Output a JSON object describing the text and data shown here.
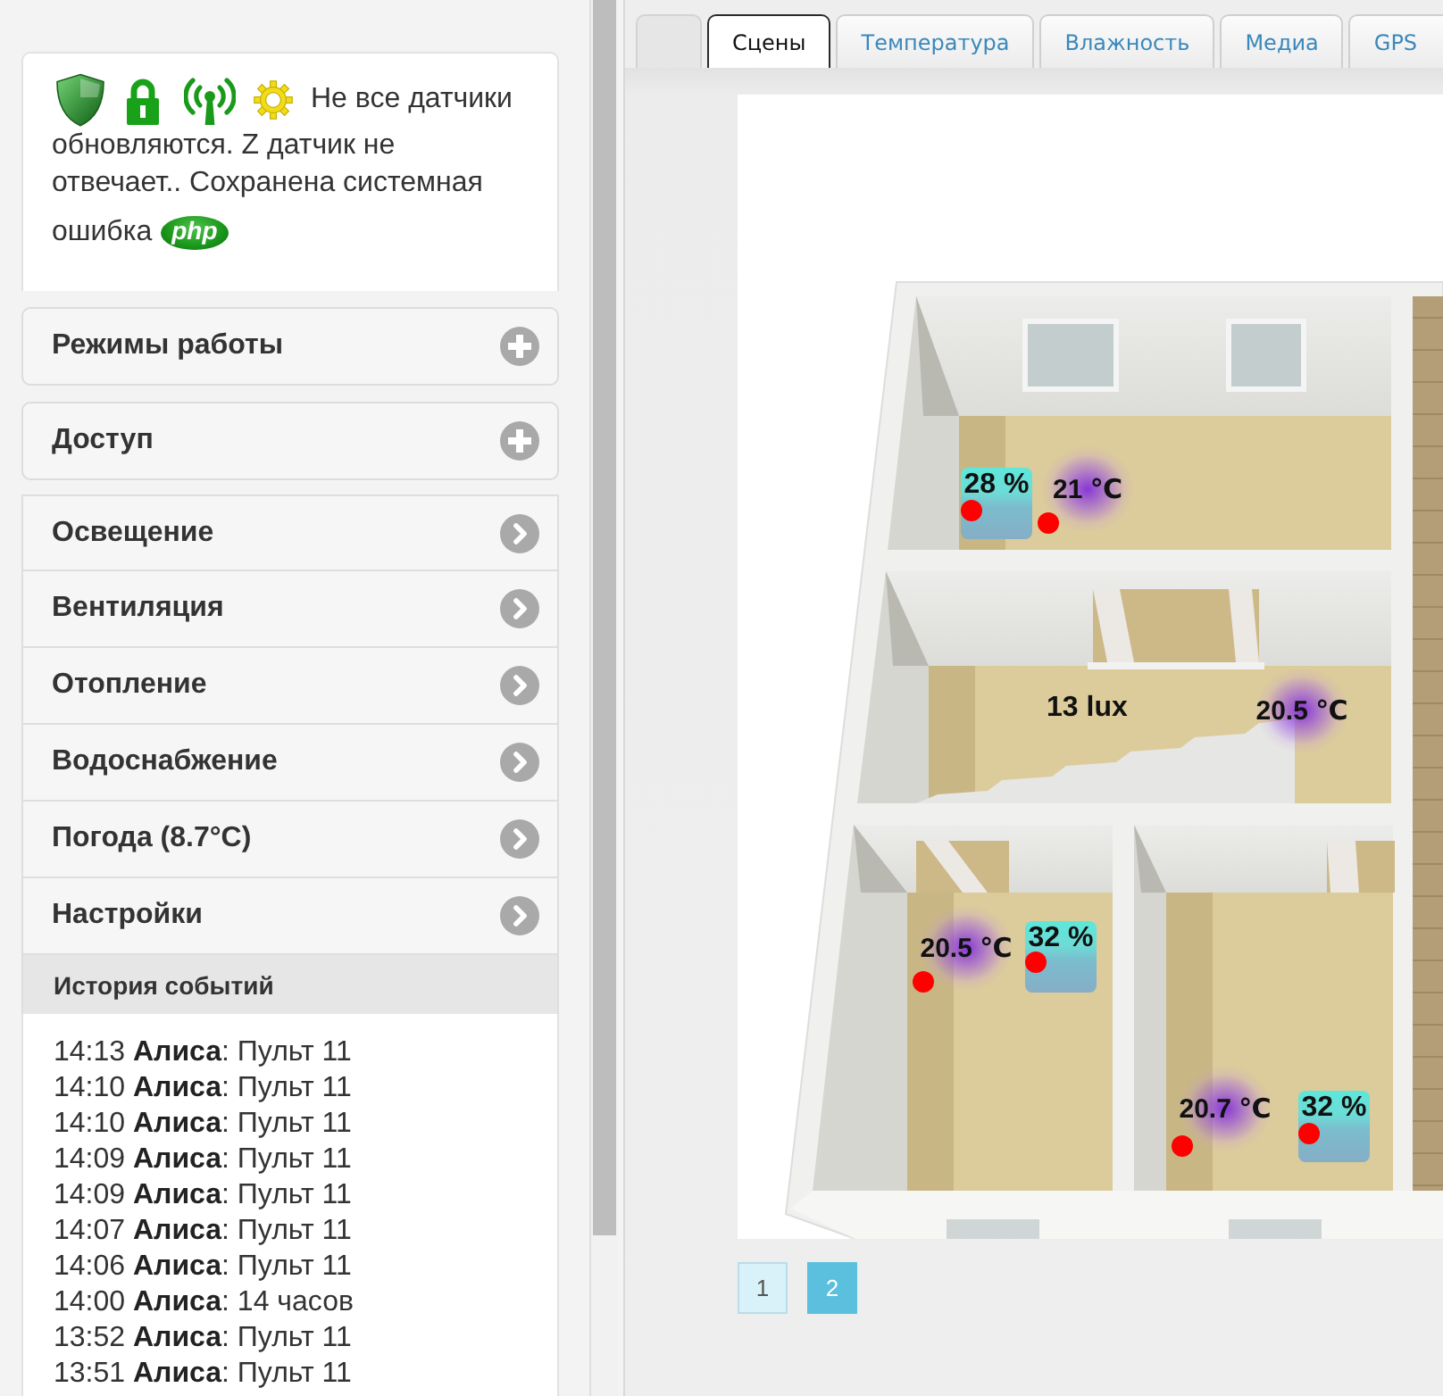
{
  "status": {
    "message": "Не все датчики обновляются. Z датчик не отвечает.. Сохранена системная ошибка",
    "badge": "php"
  },
  "sections": [
    {
      "label": "Режимы работы",
      "expanded": false
    },
    {
      "label": "Доступ",
      "expanded": false
    }
  ],
  "menu": [
    {
      "label": "Освещение"
    },
    {
      "label": "Вентиляция"
    },
    {
      "label": "Отопление"
    },
    {
      "label": "Водоснабжение"
    },
    {
      "label": "Погода (8.7°C)"
    },
    {
      "label": "Настройки"
    }
  ],
  "history": {
    "title": "История событий",
    "events": [
      "14:13 **Алиса**: Пульт 11",
      "14:10 **Алиса**: Пульт 11",
      "14:10 **Алиса**: Пульт 11",
      "14:09 **Алиса**: Пульт 11",
      "14:09 **Алиса**: Пульт 11",
      "14:07 **Алиса**: Пульт 11",
      "14:06 **Алиса**: Пульт 11",
      "14:00 **Алиса**: 14 часов",
      "13:52 **Алиса**: Пульт 11",
      "13:51 **Алиса**: Пульт 11"
    ]
  },
  "tabs": [
    {
      "kind": "blank",
      "selected": false
    },
    {
      "kind": "text",
      "label": "Сцены",
      "selected": true
    },
    {
      "kind": "text",
      "label": "Температура",
      "selected": false
    },
    {
      "kind": "text",
      "label": "Влажность",
      "selected": false
    },
    {
      "kind": "text",
      "label": "Медиа",
      "selected": false
    },
    {
      "kind": "text",
      "label": "GPS",
      "selected": false
    }
  ],
  "plan": {
    "sensors": [
      {
        "kind": "humidity",
        "reading": "28 %",
        "marked": true
      },
      {
        "kind": "temperature",
        "reading": "21 ℃",
        "marked": true
      },
      {
        "kind": "light",
        "reading": "13 lux",
        "marked": false
      },
      {
        "kind": "temperature",
        "reading": "20.5 ℃",
        "marked": false
      },
      {
        "kind": "temperature",
        "reading": "20.5 ℃",
        "marked": true
      },
      {
        "kind": "humidity",
        "reading": "32 %",
        "marked": true
      },
      {
        "kind": "temperature",
        "reading": "20.7 ℃",
        "marked": true
      },
      {
        "kind": "humidity",
        "reading": "32 %",
        "marked": true
      }
    ]
  },
  "pages": [
    {
      "label": "1",
      "selected": false
    },
    {
      "label": "2",
      "selected": true
    }
  ]
}
